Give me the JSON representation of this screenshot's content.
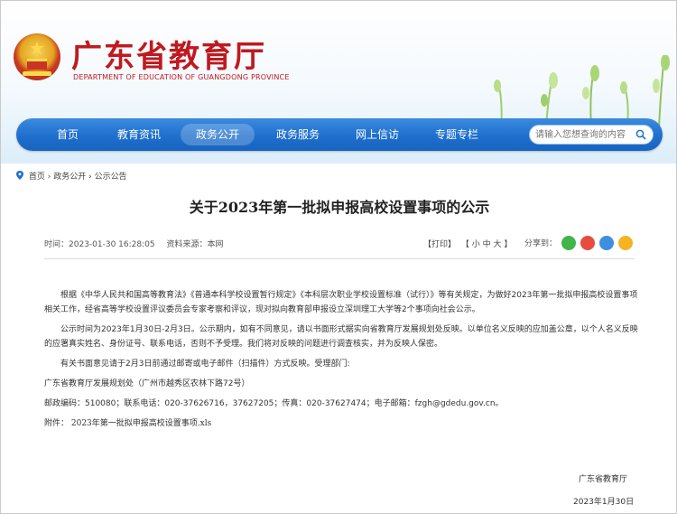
{
  "header": {
    "title": "广东省教育厅",
    "subtitle": "DEPARTMENT OF EDUCATION OF GUANGDONG PROVINCE"
  },
  "nav": {
    "items": [
      "首页",
      "教育资讯",
      "政务公开",
      "政务服务",
      "网上信访",
      "专题专栏"
    ],
    "active": "政务公开"
  },
  "search": {
    "placeholder": "请输入您想查询的内容"
  },
  "breadcrumb": {
    "home": "首页",
    "sep": "›",
    "level1": "政务公开",
    "level2": "公示公告"
  },
  "article": {
    "title": "关于2023年第一批拟申报高校设置事项的公示",
    "time_label": "时间：",
    "time": "2023-01-30 16:28:05",
    "source_label": "资料来源：",
    "source": "本网",
    "print": "【打印】",
    "font_size": "【 小  中  大 】",
    "share_label": "分享到：",
    "paragraphs": [
      "根据《中华人民共和国高等教育法》《普通本科学校设置暂行规定》《本科层次职业学校设置标准（试行）》等有关规定，为做好2023年第一批拟申报高校设置事项相关工作，经省高等学校设置评议委员会专家考察和评议，现对拟向教育部申报设立深圳理工大学等2个事项向社会公示。",
      "公示时间为2023年1月30日-2月3日。公示期内，如有不同意见，请以书面形式据实向省教育厅发展规划处反映。以单位名义反映的应加盖公章，以个人名义反映的应署真实姓名、身份证号、联系电话，否则不予受理。我们将对反映的问题进行调查核实，并为反映人保密。",
      "有关书面意见请于2月3日前通过邮寄或电子邮件（扫描件）方式反映。受理部门:",
      "广东省教育厅发展规划处（广州市越秀区农林下路72号）",
      "邮政编码：510080；联系电话：020-37626716，37627205；传真：020-37627474；电子邮箱：fzgh@gdedu.gov.cn。"
    ],
    "attachment": "附件：  2023年第一批拟申报高校设置事项.xls",
    "signature_org": "广东省教育厅",
    "signature_date": "2023年1月30日"
  },
  "share_icons": [
    "wechat-icon",
    "weibo-icon",
    "qq-icon",
    "qzone-icon"
  ],
  "colors": {
    "brand_red": "#c0191f",
    "nav_blue": "#1f6fcd"
  }
}
